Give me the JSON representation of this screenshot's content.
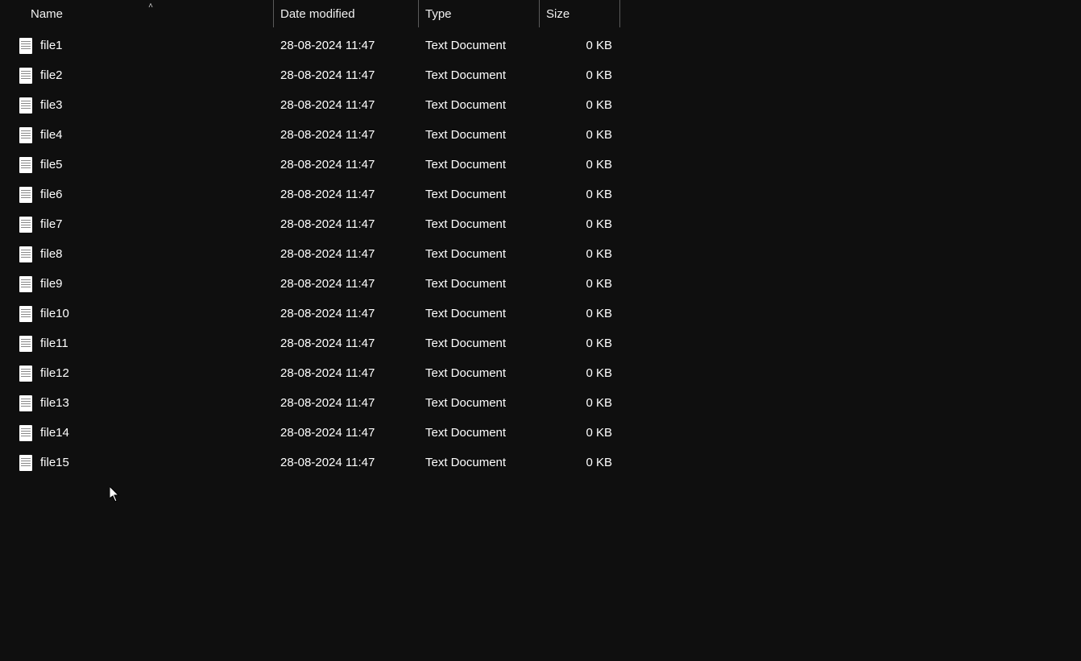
{
  "columns": {
    "name": "Name",
    "date": "Date modified",
    "type": "Type",
    "size": "Size"
  },
  "sort": {
    "column": "name",
    "direction": "asc",
    "glyph": "˄"
  },
  "files": [
    {
      "name": "file1",
      "date": "28-08-2024 11:47",
      "type": "Text Document",
      "size": "0 KB"
    },
    {
      "name": "file2",
      "date": "28-08-2024 11:47",
      "type": "Text Document",
      "size": "0 KB"
    },
    {
      "name": "file3",
      "date": "28-08-2024 11:47",
      "type": "Text Document",
      "size": "0 KB"
    },
    {
      "name": "file4",
      "date": "28-08-2024 11:47",
      "type": "Text Document",
      "size": "0 KB"
    },
    {
      "name": "file5",
      "date": "28-08-2024 11:47",
      "type": "Text Document",
      "size": "0 KB"
    },
    {
      "name": "file6",
      "date": "28-08-2024 11:47",
      "type": "Text Document",
      "size": "0 KB"
    },
    {
      "name": "file7",
      "date": "28-08-2024 11:47",
      "type": "Text Document",
      "size": "0 KB"
    },
    {
      "name": "file8",
      "date": "28-08-2024 11:47",
      "type": "Text Document",
      "size": "0 KB"
    },
    {
      "name": "file9",
      "date": "28-08-2024 11:47",
      "type": "Text Document",
      "size": "0 KB"
    },
    {
      "name": "file10",
      "date": "28-08-2024 11:47",
      "type": "Text Document",
      "size": "0 KB"
    },
    {
      "name": "file11",
      "date": "28-08-2024 11:47",
      "type": "Text Document",
      "size": "0 KB"
    },
    {
      "name": "file12",
      "date": "28-08-2024 11:47",
      "type": "Text Document",
      "size": "0 KB"
    },
    {
      "name": "file13",
      "date": "28-08-2024 11:47",
      "type": "Text Document",
      "size": "0 KB"
    },
    {
      "name": "file14",
      "date": "28-08-2024 11:47",
      "type": "Text Document",
      "size": "0 KB"
    },
    {
      "name": "file15",
      "date": "28-08-2024 11:47",
      "type": "Text Document",
      "size": "0 KB"
    }
  ]
}
